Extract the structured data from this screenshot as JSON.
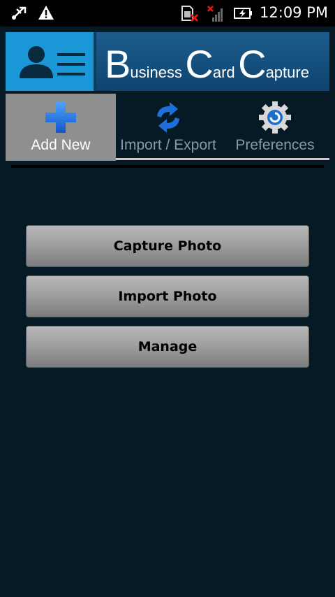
{
  "status_bar": {
    "time": "12:09 PM",
    "icons": [
      "usb-debug-icon",
      "warning-icon",
      "sim-missing-icon",
      "no-signal-icon",
      "battery-charging-icon"
    ]
  },
  "header": {
    "title_parts": [
      {
        "big": "B",
        "small": "usiness"
      },
      {
        "big": "C",
        "small": "ard"
      },
      {
        "big": "C",
        "small": "apture"
      }
    ],
    "logo_icon": "contact-list-icon"
  },
  "tabs": [
    {
      "label": "Add New",
      "icon": "add-plus-icon",
      "active": true
    },
    {
      "label": "Import / Export",
      "icon": "sync-arrows-icon",
      "active": false
    },
    {
      "label": "Preferences",
      "icon": "gear-icon",
      "active": false
    }
  ],
  "actions": {
    "capture_photo": "Capture Photo",
    "import_photo": "Import Photo",
    "manage": "Manage"
  },
  "colors": {
    "background": "#061a26",
    "logo_bg": "#1a97d6",
    "active_tab": "#8f8f8f"
  }
}
